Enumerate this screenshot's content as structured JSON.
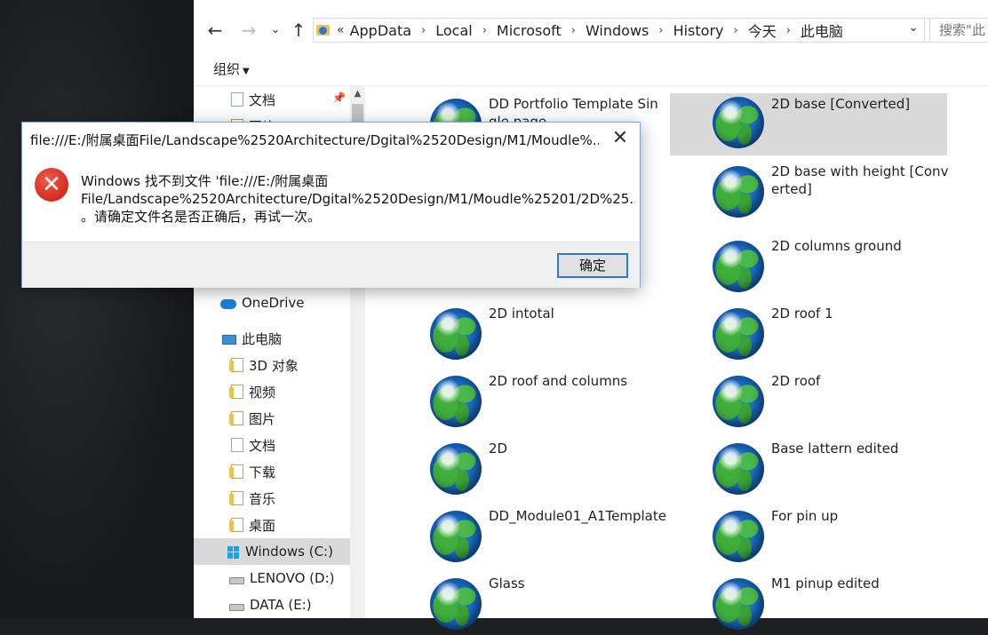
{
  "navigation": {
    "breadcrumbs": [
      "AppData",
      "Local",
      "Microsoft",
      "Windows",
      "History",
      "今天",
      "此电脑"
    ],
    "overflow_chevrons": "«",
    "search_placeholder": "搜索\"此"
  },
  "toolbar": {
    "organize_label": "组织"
  },
  "navpane": {
    "items": [
      {
        "label": "文档",
        "icon": "document-folder-icon"
      },
      {
        "label": "图片",
        "icon": "pictures-folder-icon"
      },
      {
        "label": "OneDrive",
        "icon": "onedrive-cloud-icon"
      },
      {
        "label": "此电脑",
        "icon": "this-pc-icon"
      },
      {
        "label": "3D 对象",
        "icon": "3d-objects-folder-icon"
      },
      {
        "label": "视频",
        "icon": "videos-folder-icon"
      },
      {
        "label": "图片",
        "icon": "pictures-folder-icon"
      },
      {
        "label": "文档",
        "icon": "documents-folder-icon"
      },
      {
        "label": "下载",
        "icon": "downloads-folder-icon"
      },
      {
        "label": "音乐",
        "icon": "music-folder-icon"
      },
      {
        "label": "桌面",
        "icon": "desktop-folder-icon"
      },
      {
        "label": "Windows (C:)",
        "icon": "windows-drive-icon"
      },
      {
        "label": "LENOVO (D:)",
        "icon": "drive-icon"
      },
      {
        "label": "DATA (E:)",
        "icon": "drive-icon"
      }
    ]
  },
  "files": {
    "left": [
      "DD Portfolio Template Single page",
      "2D intotal",
      "2D roof and columns",
      "2D",
      "DD_Module01_A1Template",
      "Glass"
    ],
    "right": [
      "2D base [Converted]",
      "2D base with height [Converted]",
      "2D columns ground",
      "2D roof 1",
      "2D roof",
      "Base lattern edited",
      "For pin up",
      "M1 pinup edited"
    ]
  },
  "dialog": {
    "title": "file:///E:/附属桌面File/Landscape%2520Architecture/Dgital%2520Design/M1/Moudle%...",
    "message_line1": "Windows 找不到文件 'file:///E:/附属桌面",
    "message_line2": "File/Landscape%2520Architecture/Dgital%2520Design/M1/Moudle%25201/2D%25...",
    "message_line3": "。请确定文件名是否正确后，再试一次。",
    "ok_label": "确定"
  },
  "colors": {
    "accent": "#2b79d6",
    "error": "#d52b1e",
    "selection": "#d9d9d9"
  }
}
